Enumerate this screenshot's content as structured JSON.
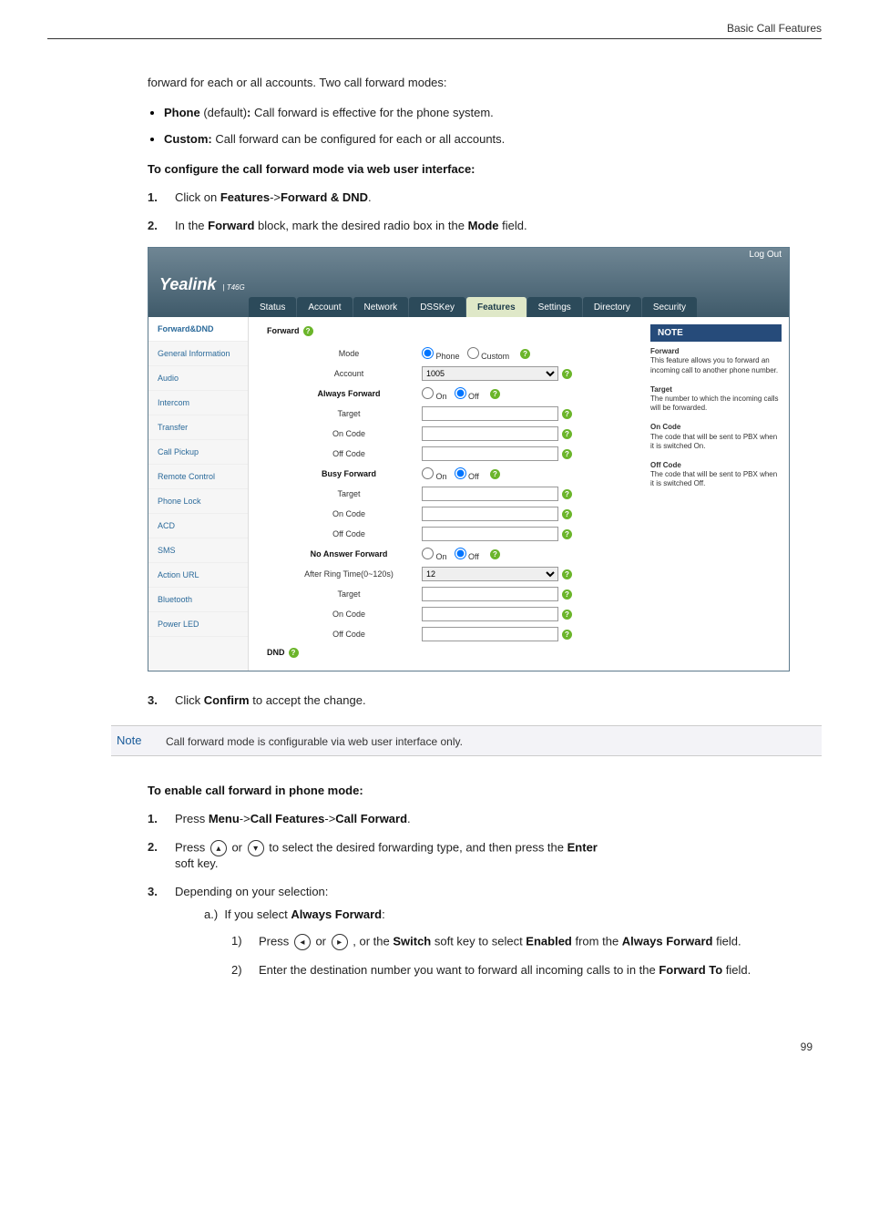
{
  "header": {
    "section": "Basic Call Features"
  },
  "intro": {
    "lead": "forward for each or all accounts. Two call forward modes:",
    "bullets": [
      {
        "b": "Phone",
        "suffix": " (default)",
        "colon": ":",
        "rest": " Call forward is effective for the phone system."
      },
      {
        "b": "Custom:",
        "suffix": "",
        "colon": "",
        "rest": " Call forward can be configured for each or all accounts."
      }
    ]
  },
  "configure_title": "To configure the call forward mode via web user interface:",
  "configure_steps": {
    "s1_a": "Click on ",
    "s1_b1": "Features",
    "s1_arrow": "->",
    "s1_b2": "Forward & DND",
    "s1_end": ".",
    "s2_a": "In the ",
    "s2_b1": "Forward",
    "s2_mid": " block, mark the desired radio box in the ",
    "s2_b2": "Mode",
    "s2_end": " field."
  },
  "screenshot": {
    "logout": "Log Out",
    "brand": "Yealink",
    "brand_model": "T46G",
    "tabs": [
      "Status",
      "Account",
      "Network",
      "DSSKey",
      "Features",
      "Settings",
      "Directory",
      "Security"
    ],
    "active_tab_index": 4,
    "sidebar": [
      "Forward&DND",
      "General Information",
      "Audio",
      "Intercom",
      "Transfer",
      "Call Pickup",
      "Remote Control",
      "Phone Lock",
      "ACD",
      "SMS",
      "Action URL",
      "Bluetooth",
      "Power LED"
    ],
    "sidebar_sel_index": 0,
    "sections": {
      "forward": "Forward",
      "dnd": "DND"
    },
    "rows": {
      "mode": "Mode",
      "mode_phone": "Phone",
      "mode_custom": "Custom",
      "account": "Account",
      "account_val": "1005",
      "always_forward": "Always Forward",
      "busy_forward": "Busy Forward",
      "no_answer_forward": "No Answer Forward",
      "target": "Target",
      "on_code": "On Code",
      "off_code": "Off Code",
      "after_ring": "After Ring Time(0~120s)",
      "after_ring_val": "12",
      "on": "On",
      "off": "Off"
    },
    "note": {
      "title": "NOTE",
      "forward_h": "Forward",
      "forward_t": "This feature allows you to forward an incoming call to another phone number.",
      "target_h": "Target",
      "target_t": "The number to which the incoming calls will be forwarded.",
      "oncode_h": "On Code",
      "oncode_t": "The code that will be sent to PBX when it is switched On.",
      "offcode_h": "Off Code",
      "offcode_t": "The code that will be sent to PBX when it is switched Off."
    }
  },
  "step3": {
    "a": "Click ",
    "b": "Confirm",
    "c": " to accept the change."
  },
  "note_callout": {
    "label": "Note",
    "body": "Call forward mode is configurable via web user interface only."
  },
  "enable_title": "To enable call forward in phone mode:",
  "enable_steps": {
    "s1_a": "Press ",
    "s1_b1": "Menu",
    "s1_ar1": "->",
    "s1_b2": "Call Features",
    "s1_ar2": "->",
    "s1_b3": "Call Forward",
    "s1_end": ".",
    "s2_a": "Press ",
    "s2_or": " or ",
    "s2_mid": "  to select the desired forwarding type, and then press the ",
    "s2_b": "Enter",
    "s2_end": "soft key.",
    "s3": "Depending on your selection:",
    "s3a_a": "If you select ",
    "s3a_b": "Always Forward",
    "s3a_c": ":",
    "s3a1_a": "Press ",
    "s3a1_or": " or ",
    "s3a1_mid": " , or the ",
    "s3a1_b1": "Switch",
    "s3a1_mid2": " soft key to select ",
    "s3a1_b2": "Enabled",
    "s3a1_mid3": " from the ",
    "s3a1_b3": "Always Forward",
    "s3a1_end": " field.",
    "s3a2_a": "Enter the destination number you want to forward all incoming calls to in the ",
    "s3a2_b": "Forward To",
    "s3a2_end": " field."
  },
  "glyphs": {
    "up": "▴",
    "down": "▾",
    "left": "◂",
    "right": "▸"
  },
  "page_number": "99"
}
